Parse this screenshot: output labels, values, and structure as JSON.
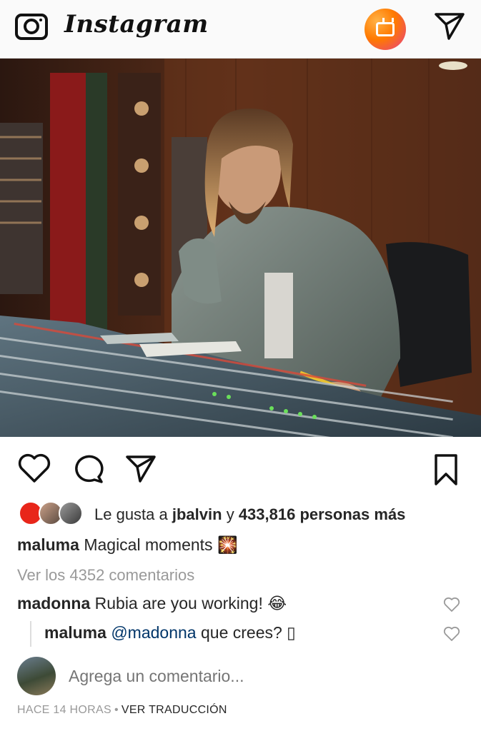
{
  "header": {
    "logo_text": "Instagram",
    "icons": [
      "camera-icon",
      "igtv-icon",
      "direct-send-icon"
    ],
    "igtv_gradient": [
      "#ffb347",
      "#ff7a00",
      "#e63c8a"
    ]
  },
  "post": {
    "actions": [
      "heart-icon",
      "comment-icon",
      "share-icon",
      "bookmark-icon"
    ],
    "likes": {
      "prefix": "Le gusta a",
      "user": "jbalvin",
      "connector": "y",
      "count_text": "433,816 personas más"
    },
    "caption": {
      "username": "maluma",
      "text": "Magical moments 🎇"
    },
    "view_comments": "Ver los 4352 comentarios",
    "comments": [
      {
        "username": "madonna",
        "text": "Rubia are you working! 😂"
      }
    ],
    "reply": {
      "username": "maluma",
      "mention": "@madonna",
      "text": "que crees? ▯"
    },
    "add_comment_placeholder": "Agrega un comentario...",
    "timestamp": "HACE 14 HORAS",
    "separator": "•",
    "translate": "VER TRADUCCIÓN"
  },
  "colors": {
    "mention": "#003569",
    "muted": "#999999",
    "text": "#262626"
  }
}
